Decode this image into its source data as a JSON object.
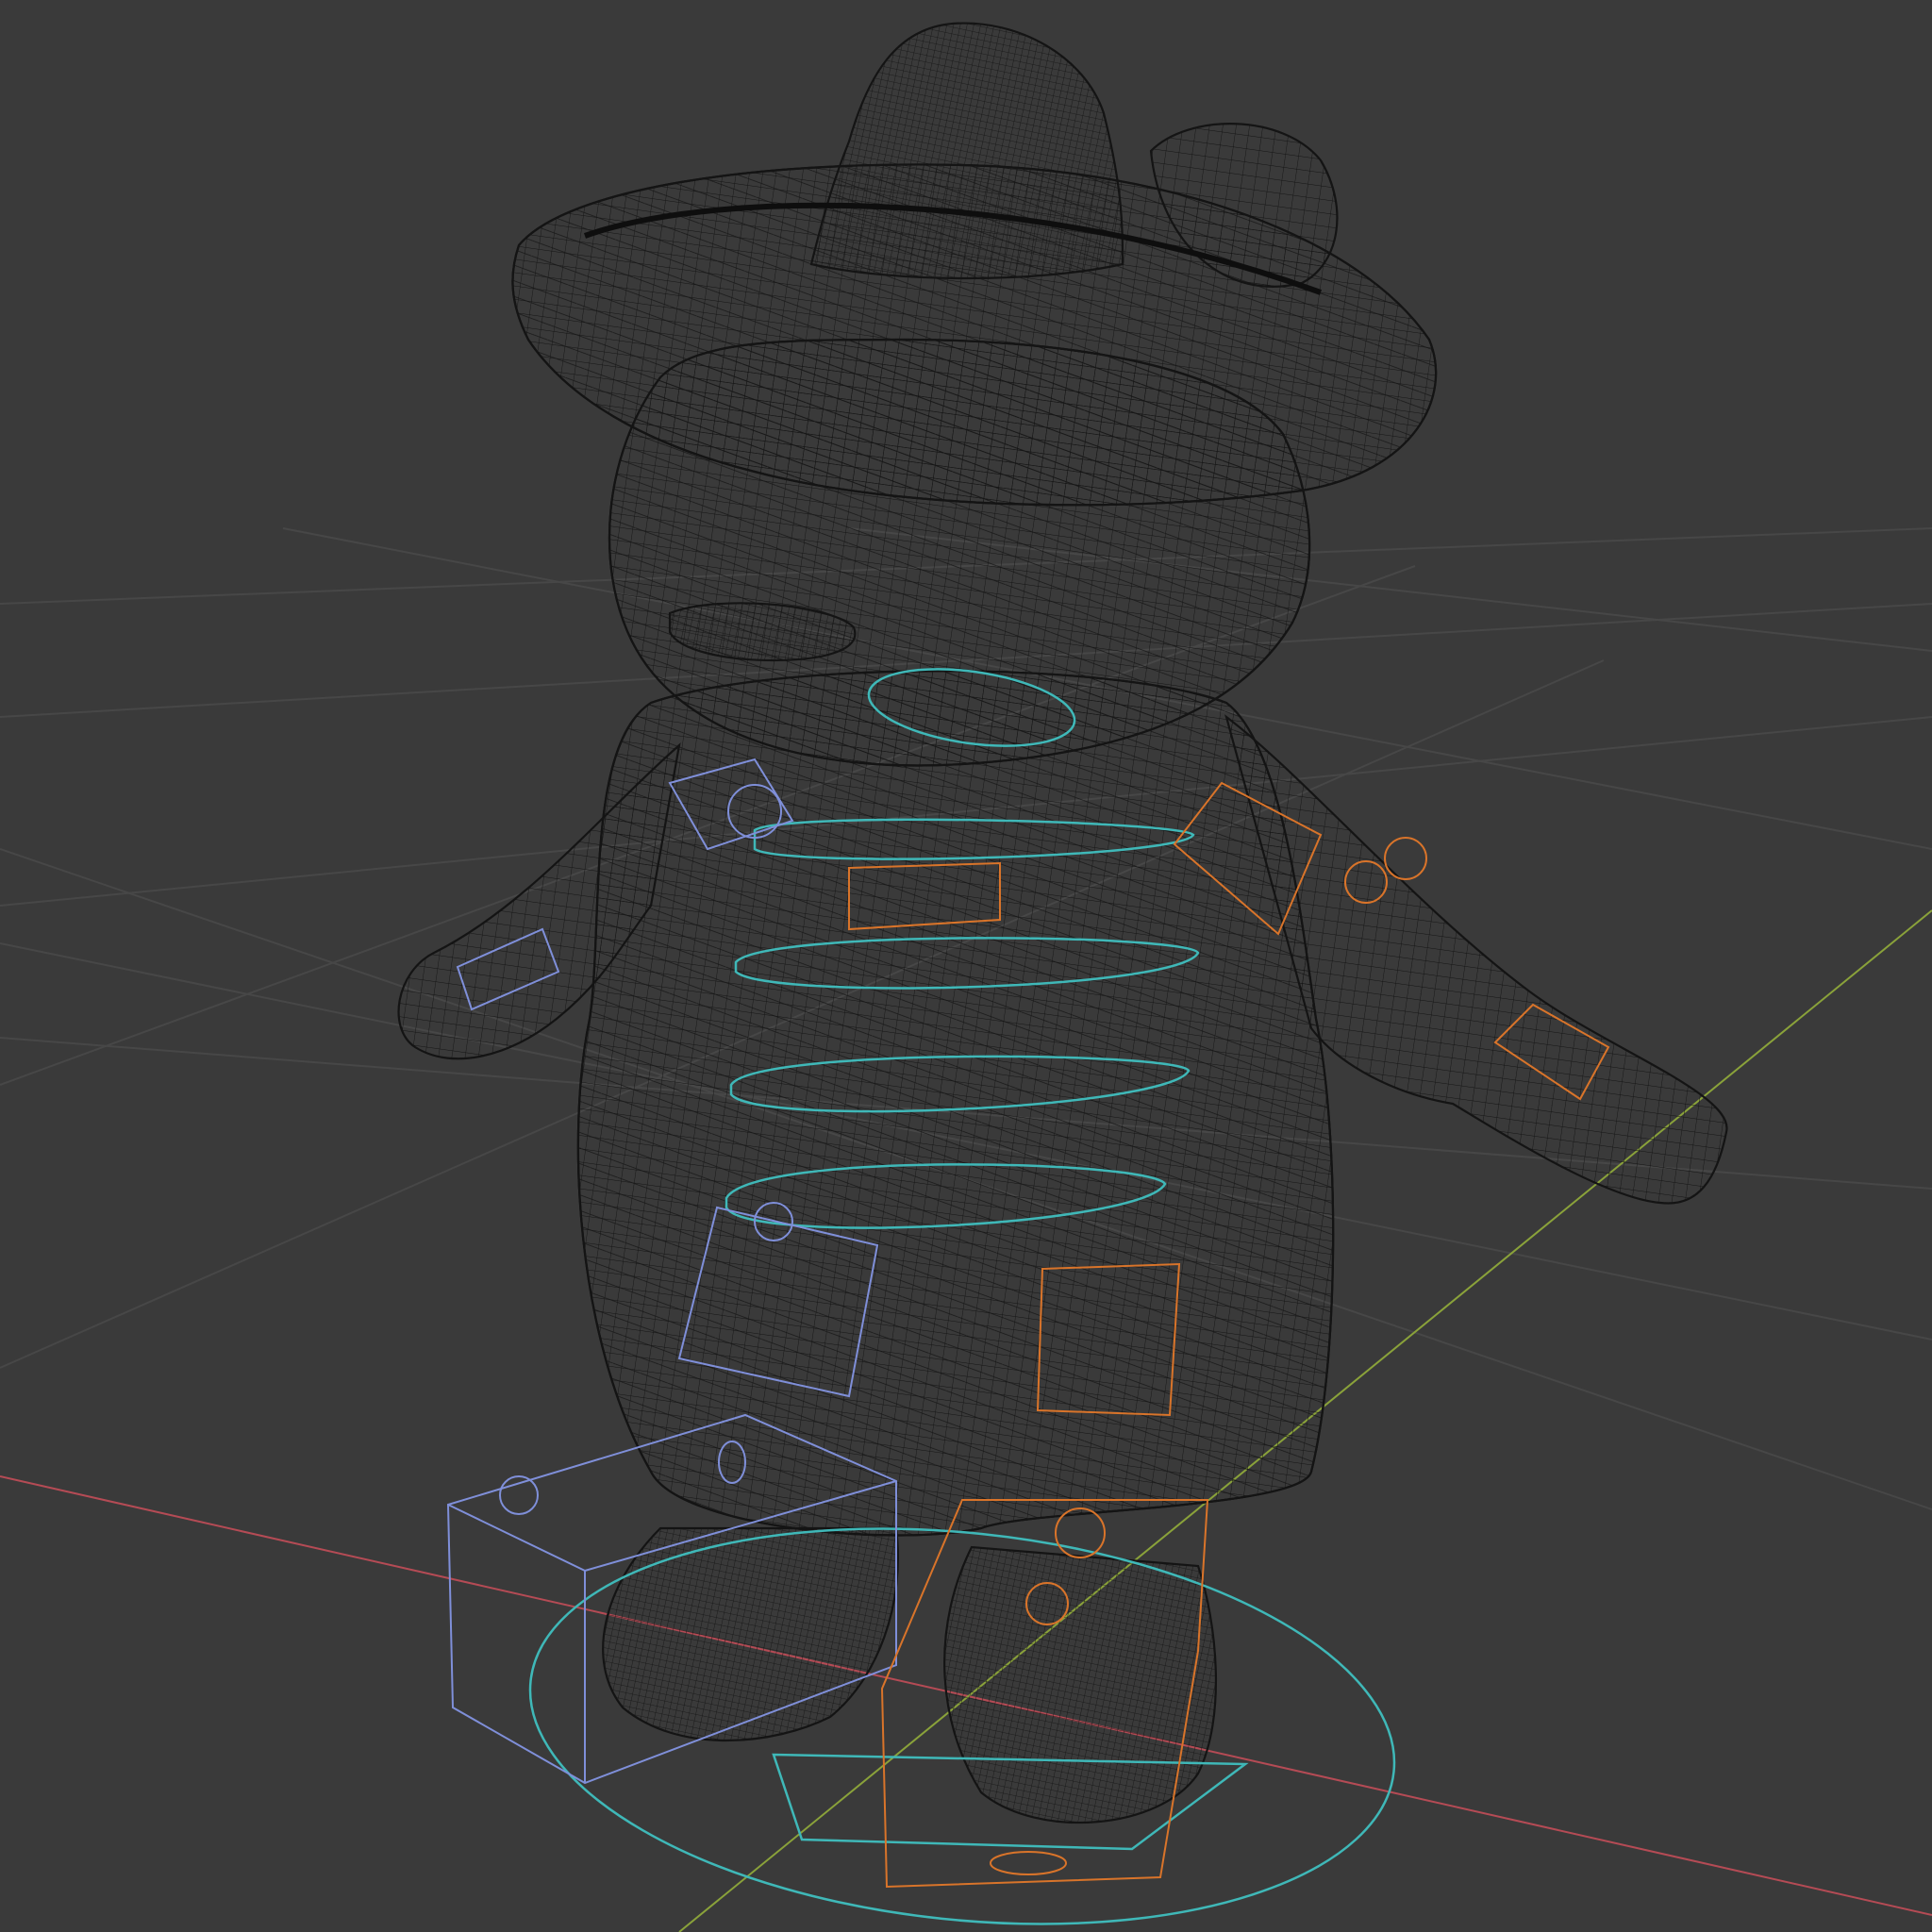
{
  "viewport": {
    "background": "#3a3a3a",
    "grid_color": "#4a4a4a",
    "x_axis_color": "#b54b55",
    "y_axis_color": "#8aa23a",
    "mesh_color": "#141414",
    "rig_colors": {
      "spine_controls": "#3fb8b8",
      "left_side_controls": "#7f8fd9",
      "right_side_controls": "#d9742a"
    }
  },
  "scene": {
    "object": "character-mesh",
    "display_mode": "wireframe",
    "icon": "bear-character-icon"
  }
}
